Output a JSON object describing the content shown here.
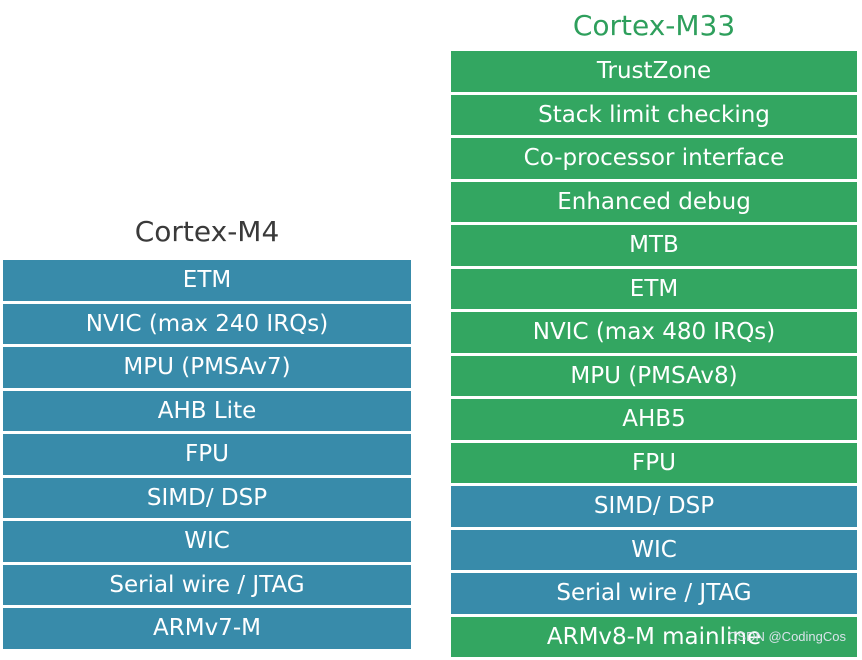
{
  "colors": {
    "blue": "#388baa",
    "green": "#33a661",
    "m33_title": "#2e9f5c",
    "m4_title": "#3a3a3a"
  },
  "m4": {
    "title": "Cortex-M4",
    "rows": [
      {
        "label": "ETM",
        "color": "blue"
      },
      {
        "label": "NVIC (max 240 IRQs)",
        "color": "blue"
      },
      {
        "label": "MPU (PMSAv7)",
        "color": "blue"
      },
      {
        "label": "AHB Lite",
        "color": "blue"
      },
      {
        "label": "FPU",
        "color": "blue"
      },
      {
        "label": "SIMD/ DSP",
        "color": "blue"
      },
      {
        "label": "WIC",
        "color": "blue"
      },
      {
        "label": "Serial wire / JTAG",
        "color": "blue"
      },
      {
        "label": "ARMv7-M",
        "color": "blue"
      }
    ]
  },
  "m33": {
    "title": "Cortex-M33",
    "rows": [
      {
        "label": "TrustZone",
        "color": "green"
      },
      {
        "label": "Stack limit checking",
        "color": "green"
      },
      {
        "label": "Co-processor interface",
        "color": "green"
      },
      {
        "label": "Enhanced debug",
        "color": "green"
      },
      {
        "label": "MTB",
        "color": "green"
      },
      {
        "label": "ETM",
        "color": "green"
      },
      {
        "label": "NVIC (max 480 IRQs)",
        "color": "green"
      },
      {
        "label": "MPU (PMSAv8)",
        "color": "green"
      },
      {
        "label": "AHB5",
        "color": "green"
      },
      {
        "label": "FPU",
        "color": "green"
      },
      {
        "label": "SIMD/ DSP",
        "color": "blue"
      },
      {
        "label": "WIC",
        "color": "blue"
      },
      {
        "label": "Serial wire / JTAG",
        "color": "blue"
      },
      {
        "label": "ARMv8-M mainline",
        "color": "green"
      }
    ]
  },
  "watermark": "CSDN @CodingCos"
}
